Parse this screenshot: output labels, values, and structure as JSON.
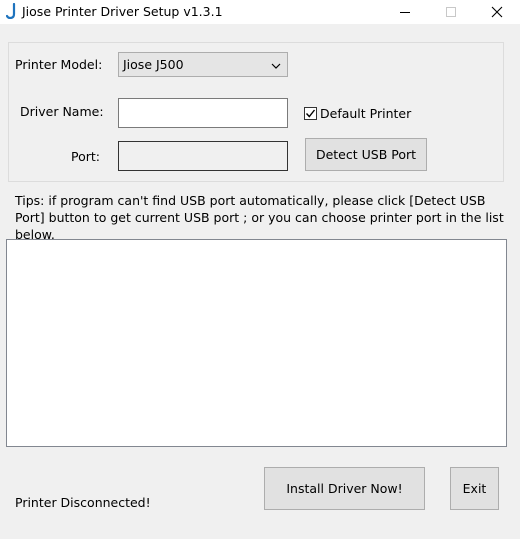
{
  "window": {
    "title": "Jiose Printer Driver Setup v1.3.1",
    "icon": "app-logo-icon",
    "controls": [
      "minimize-icon",
      "maximize-icon",
      "close-icon"
    ]
  },
  "form": {
    "printer_model_label": "Printer Model:",
    "printer_model_value": "Jiose J500",
    "driver_name_label": "Driver Name:",
    "driver_name_value": "",
    "default_printer_label": "Default Printer",
    "default_printer_checked": true,
    "port_label": "Port:",
    "port_value": "",
    "detect_usb_label": "Detect USB Port"
  },
  "tips": "Tips: if program can't find USB port automatically, please click [Detect USB Port] button to get current USB port ; or you can choose printer port in the list below.",
  "port_list": [],
  "actions": {
    "install_label": "Install Driver Now!",
    "exit_label": "Exit"
  },
  "status": "Printer Disconnected!",
  "colors": {
    "window_bg": "#f0f0f0",
    "button_bg": "#e1e1e1",
    "logo_blue": "#1e73be"
  }
}
